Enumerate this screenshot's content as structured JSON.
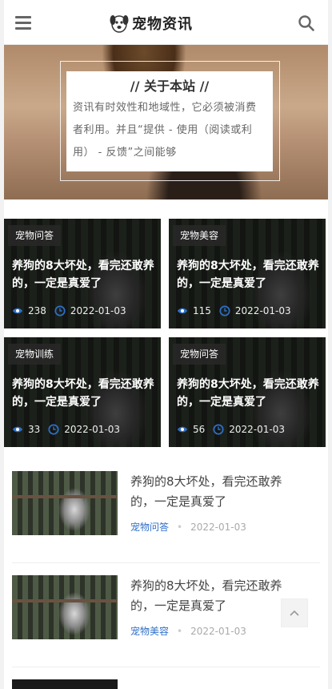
{
  "header": {
    "logo_text": "宠物资讯",
    "menu_icon": "hamburger-menu-icon",
    "search_icon": "search-icon"
  },
  "hero": {
    "title": "// 关于本站 //",
    "text": "资讯有时效性和地域性，它必须被消费者利用。并且“提供 - 使用（阅读或利用） - 反馈”之间能够"
  },
  "cards": [
    {
      "tag": "宠物问答",
      "title": "养狗的8大坏处，看完还敢养的，一定是真爱了",
      "views": "238",
      "date": "2022-01-03"
    },
    {
      "tag": "宠物美容",
      "title": "养狗的8大坏处，看完还敢养的，一定是真爱了",
      "views": "115",
      "date": "2022-01-03"
    },
    {
      "tag": "宠物训练",
      "title": "养狗的8大坏处，看完还敢养的，一定是真爱了",
      "views": "33",
      "date": "2022-01-03"
    },
    {
      "tag": "宠物问答",
      "title": "养狗的8大坏处，看完还敢养的，一定是真爱了",
      "views": "56",
      "date": "2022-01-03"
    }
  ],
  "list": [
    {
      "title": "养狗的8大坏处，看完还敢养的，一定是真爱了",
      "category": "宠物问答",
      "date": "2022-01-03"
    },
    {
      "title": "养狗的8大坏处，看完还敢养的，一定是真爱了",
      "category": "宠物美容",
      "date": "2022-01-03"
    }
  ],
  "colors": {
    "accent_link": "#2f6fc7",
    "icon_blue": "#2f6fc7"
  }
}
